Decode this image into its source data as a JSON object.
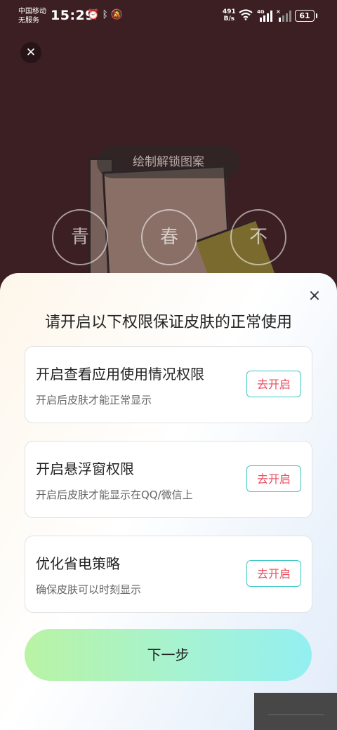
{
  "status_bar": {
    "carrier_line1": "中国移动",
    "carrier_line2": "无服务",
    "time": "15:29",
    "net_speed_value": "491",
    "net_speed_unit": "B/s",
    "battery": "61",
    "icons": [
      "alarm-icon",
      "bluetooth-icon",
      "mute-icon",
      "wifi-icon",
      "signal-4g-icon",
      "signal-icon",
      "battery-icon"
    ]
  },
  "preview": {
    "lock_hint": "绘制解锁图案",
    "circles": [
      "青",
      "春",
      "不"
    ]
  },
  "sheet": {
    "close_label": "×",
    "title": "请开启以下权限保证皮肤的正常使用",
    "permissions": [
      {
        "title": "开启查看应用使用情况权限",
        "desc": "开启后皮肤才能正常显示",
        "button": "去开启"
      },
      {
        "title": "开启悬浮窗权限",
        "desc": "开启后皮肤才能显示在QQ/微信上",
        "button": "去开启"
      },
      {
        "title": "优化省电策略",
        "desc": "确保皮肤可以时刻显示",
        "button": "去开启"
      }
    ],
    "next_button": "下一步"
  },
  "colors": {
    "button_border": "#3ec7c4",
    "button_text": "#e94e5c",
    "background": "#3c1f22"
  }
}
